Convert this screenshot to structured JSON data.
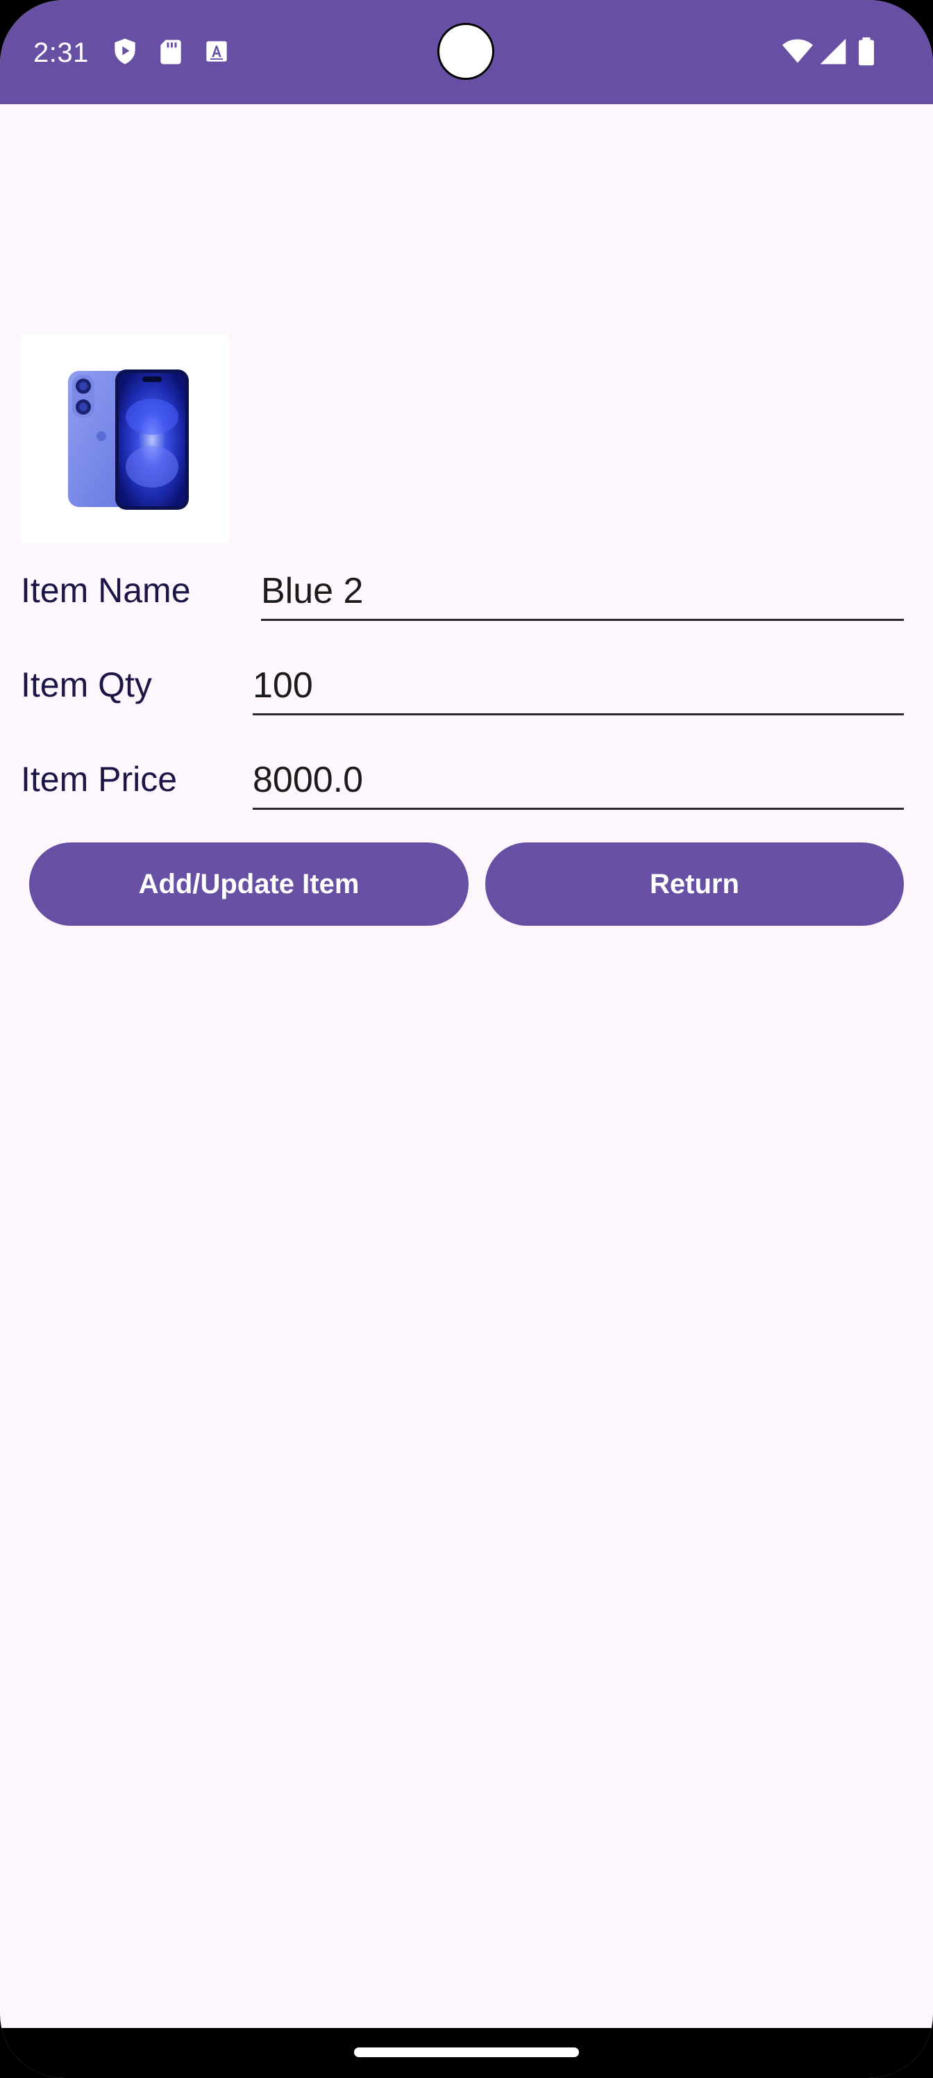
{
  "status_bar": {
    "time": "2:31",
    "icons": [
      "play-shield-icon",
      "sd-card-icon",
      "keyboard-a-icon",
      "wifi-icon",
      "cellular-signal-icon",
      "battery-icon"
    ]
  },
  "product": {
    "image_alt": "Blue iPhone",
    "image_icon": "phone-image"
  },
  "form": {
    "name_label": "Item Name",
    "name_value": "Blue 2",
    "qty_label": "Item Qty",
    "qty_value": "100",
    "price_label": "Item Price",
    "price_value": "8000.0"
  },
  "actions": {
    "add_update_label": "Add/Update Item",
    "return_label": "Return"
  },
  "colors": {
    "primary": "#6750a4",
    "background": "#fdf6fc",
    "label_text": "#1c1646"
  }
}
